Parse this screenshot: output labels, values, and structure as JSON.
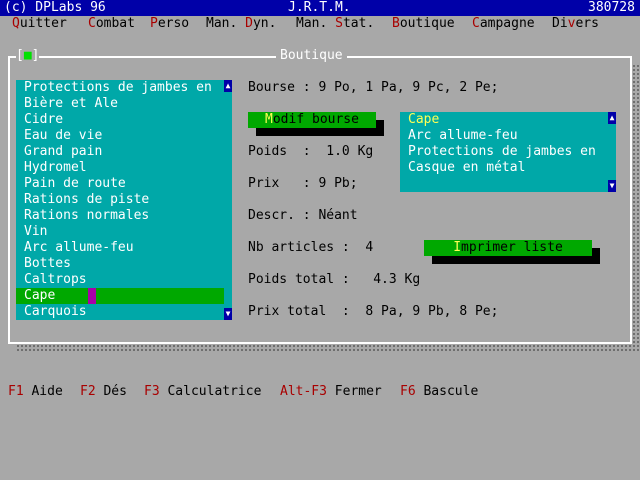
{
  "titlebar": {
    "left": "(c) DPLabs 96",
    "center": "J.R.T.M.",
    "right": "380728"
  },
  "menu": [
    {
      "hot": "Q",
      "rest": "uitter"
    },
    {
      "hot": "C",
      "rest": "ombat"
    },
    {
      "hot": "P",
      "rest": "erso"
    },
    {
      "hot": "",
      "rest": "Man. ",
      "hot2": "D",
      "rest2": "yn."
    },
    {
      "hot": "",
      "rest": "Man. ",
      "hot2": "S",
      "rest2": "tat."
    },
    {
      "hot": "B",
      "rest": "outique"
    },
    {
      "hot": "C",
      "rest": "ampagne"
    },
    {
      "hot": "",
      "rest": "Di",
      "hot2": "v",
      "rest2": "ers"
    }
  ],
  "window": {
    "title": "Boutique",
    "close": "[■]"
  },
  "items_list": [
    "Protections de jambes en",
    "Bière et Ale",
    "Cidre",
    "Eau de vie",
    "Grand pain",
    "Hydromel",
    "Pain de route",
    "Rations de piste",
    "Rations normales",
    "Vin",
    "Arc allume-feu",
    "Bottes",
    "Caltrops",
    "Cape",
    "Carquois"
  ],
  "selected_item": "Cape",
  "bourse": "Bourse : 9 Po, 1 Pa, 9 Pc, 2 Pe;",
  "modif_button": {
    "hot": "M",
    "rest": "odif bourse"
  },
  "poids": "Poids  :  1.0 Kg",
  "prix": "Prix   : 9 Pb;",
  "descr": "Descr. : Néant",
  "nb_articles": "Nb articles :  4",
  "imprimer_button": {
    "hot": "I",
    "rest": "mprimer liste"
  },
  "poids_total": "Poids total :   4.3 Kg",
  "prix_total": "Prix total  :  8 Pa, 9 Pb, 8 Pe;",
  "cart_list": [
    "Cape",
    "Arc allume-feu",
    "Protections de jambes en",
    "Casque en métal"
  ],
  "cart_selected": "Cape",
  "footer": [
    {
      "key": "F1",
      "label": " Aide"
    },
    {
      "key": "F2",
      "label": " Dés"
    },
    {
      "key": "F3",
      "label": " Calculatrice"
    },
    {
      "key": "Alt-F3",
      "label": " Fermer"
    },
    {
      "key": "F6",
      "label": " Bascule"
    }
  ],
  "colors": {
    "title_bg": "#0000a8",
    "list_bg": "#00a8a8",
    "selection": "#00a800",
    "hotkey": "#a80000"
  }
}
